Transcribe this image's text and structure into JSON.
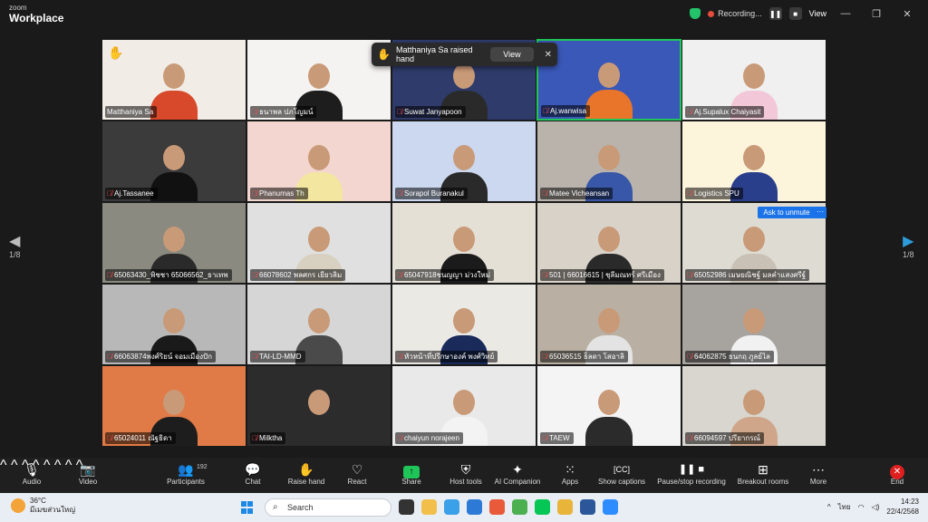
{
  "window": {
    "brand_top": "zoom",
    "brand_bottom": "Workplace",
    "recording_label": "Recording...",
    "view_label": "View"
  },
  "pager": {
    "left_label": "1/8",
    "right_label": "1/8"
  },
  "toast": {
    "text": "Matthaniya Sa raised hand",
    "view_button": "View"
  },
  "ask_unmute": {
    "label": "Ask to unmute",
    "more": "···"
  },
  "tiles": [
    {
      "name": "Matthaniya Sa",
      "muted": false,
      "hand": true,
      "bg": "#f1ece6",
      "shirt": "#d8482a"
    },
    {
      "name": "ธนาพล ปภโญมน์",
      "muted": true,
      "bg": "#f5f3f2",
      "shirt": "#1d1d1d"
    },
    {
      "name": "Suwat Janyapoon",
      "muted": true,
      "bg": "#2f3b6b",
      "shirt": "#2a2a2a"
    },
    {
      "name": "Aj.wanwisa",
      "muted": true,
      "active": true,
      "bg": "#3a58b8",
      "shirt": "#e8752a"
    },
    {
      "name": "Aj.Supalux Chaiyasit",
      "muted": true,
      "bg": "#f0f0f0",
      "shirt": "#f2c8d8"
    },
    {
      "name": "Aj.Tassanee",
      "muted": true,
      "bg": "#3b3b3b",
      "shirt": "#111111"
    },
    {
      "name": "Phanumas Th",
      "muted": true,
      "bg": "#f3d6cf",
      "shirt": "#f3e6a0"
    },
    {
      "name": "Sorapol Buranakul",
      "muted": true,
      "bg": "#cbd8ef",
      "shirt": "#2a2a2a"
    },
    {
      "name": "Matee Vicheansan",
      "muted": true,
      "bg": "#b9b3ab",
      "shirt": "#3857a8"
    },
    {
      "name": "Logistics SPU",
      "muted": true,
      "bg": "#fdf4dc",
      "shirt": "#2a3f8c"
    },
    {
      "name": "65063430_พิชชา 65066562_ธาเทพ",
      "muted": true,
      "bg": "#8a8a80",
      "shirt": "#2a2a2a"
    },
    {
      "name": "66078602 พลศกร เยียวลิม",
      "muted": true,
      "bg": "#e0e0e0",
      "shirt": "#d8d0c0"
    },
    {
      "name": "65047918ชนญญา ม่วงใหม่",
      "muted": true,
      "bg": "#e4e0d6",
      "shirt": "#1b1b1b"
    },
    {
      "name": "501 | 66016615 | ชุลีมณทร์ ศรีเมือง",
      "muted": true,
      "bg": "#d9d2c8",
      "shirt": "#2a2a2a"
    },
    {
      "name": "65052986 เมษยณิชฐ์ มลคำแสงศรีฐ์",
      "muted": true,
      "bg": "#dedbd3",
      "shirt": "#c9c1b5"
    },
    {
      "name": "66063874พงศ์ริยน์ จอมเมืองปัก",
      "muted": true,
      "bg": "#b8b8b8",
      "shirt": "#1a1a1a"
    },
    {
      "name": "TAI-LD-MMD",
      "muted": true,
      "bg": "#d6d6d6",
      "shirt": "#4a4a4a"
    },
    {
      "name": "หัวหน้าที่ปรึกษาองค์ พงศ์วิทย์",
      "muted": true,
      "bg": "#ebe9e4",
      "shirt": "#1a2a5a"
    },
    {
      "name": "65036515 ธ็ลดา โสอาลิ",
      "muted": true,
      "bg": "#b9b0a3",
      "shirt": "#e3e3e3"
    },
    {
      "name": "64062875 ธนกฤ ภูลย์ไล",
      "muted": true,
      "bg": "#a7a4a0",
      "shirt": "#f1f1f1"
    },
    {
      "name": "65024011 ณัฐธิดา",
      "muted": true,
      "bg": "#e07a46",
      "shirt": "#1d1d1d"
    },
    {
      "name": "Milktha",
      "muted": true,
      "bg": "#2c2c2c",
      "shirt": "#2c2c2c"
    },
    {
      "name": "chaiyun norajeen",
      "muted": true,
      "bg": "#e9e9e9",
      "shirt": "#f3f3f3"
    },
    {
      "name": "TAEW",
      "muted": true,
      "bg": "#f4f4f4",
      "shirt": "#2b2b2b"
    },
    {
      "name": "66094597 ปรียากรณ์",
      "muted": true,
      "bg": "#d8d6cf",
      "shirt": "#cfa68a"
    }
  ],
  "toolbar": {
    "audio": "Audio",
    "video": "Video",
    "participants": "Participants",
    "participants_count": "192",
    "chat": "Chat",
    "raise_hand": "Raise hand",
    "react": "React",
    "share": "Share",
    "host_tools": "Host tools",
    "ai_companion": "AI Companion",
    "apps": "Apps",
    "show_captions": "Show captions",
    "pause_recording": "Pause/stop recording",
    "breakout_rooms": "Breakout rooms",
    "more": "More",
    "end": "End"
  },
  "taskbar": {
    "temperature": "36°C",
    "weather_desc": "มีเมฆส่วนใหญ่",
    "search_placeholder": "Search",
    "language": "ไทย",
    "time": "14:23",
    "date": "22/4/2568"
  },
  "colors": {
    "accent_green": "#20c55a",
    "accent_blue": "#1a73e8",
    "danger_red": "#e02020"
  }
}
